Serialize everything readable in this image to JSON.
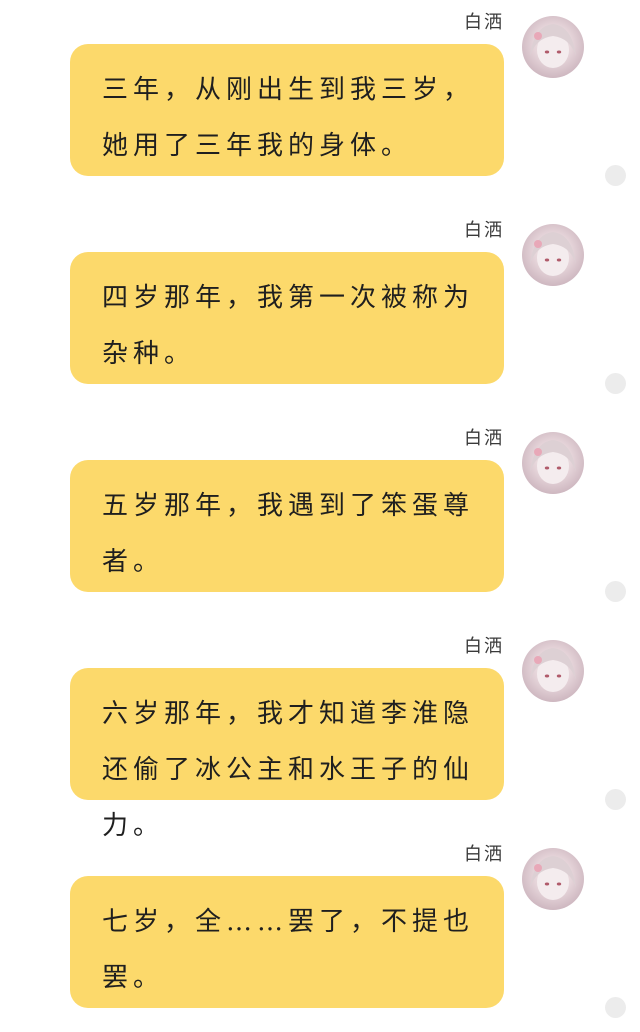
{
  "messages": [
    {
      "sender": "白洒",
      "text": "三年，从刚出生到我三岁，她用了三年我的身体。"
    },
    {
      "sender": "白洒",
      "text": "四岁那年，我第一次被称为杂种。"
    },
    {
      "sender": "白洒",
      "text": "五岁那年，我遇到了笨蛋尊者。"
    },
    {
      "sender": "白洒",
      "text": "六岁那年，我才知道李淮隐还偷了冰公主和水王子的仙力。"
    },
    {
      "sender": "白洒",
      "text": "七岁，全……罢了，不提也罢。"
    }
  ],
  "colors": {
    "bubble": "#fcd96b",
    "status_dot": "#ececec"
  },
  "icons": {
    "avatar": "anime-girl-avatar",
    "status": "status-dot-icon"
  }
}
